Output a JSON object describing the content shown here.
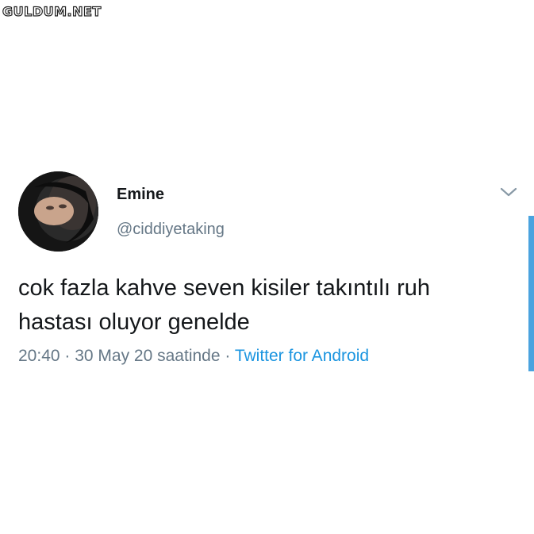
{
  "watermark": "GULDUM.NET",
  "tweet": {
    "display_name": "Emine",
    "handle": "@ciddiyetaking",
    "text": "cok fazla kahve seven kisiler takıntılı ruh hastası oluyor genelde",
    "time": "20:40",
    "separator": " · ",
    "date": "30 May 20 saatinde",
    "separator2": " · ",
    "source": "Twitter for Android"
  },
  "colors": {
    "text": "#14171a",
    "secondary": "#657786",
    "link": "#1b95e0",
    "scrollbar": "#4aa3df"
  },
  "icons": {
    "menu": "chevron-down-icon"
  }
}
